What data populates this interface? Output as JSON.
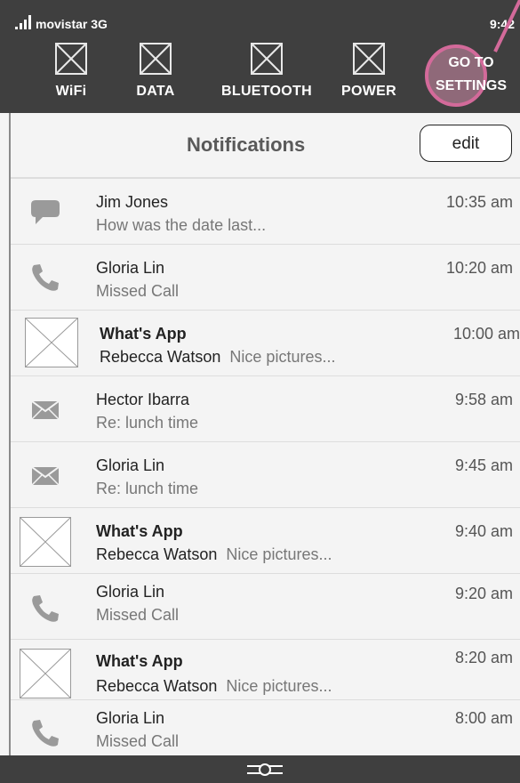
{
  "status": {
    "carrier": "movistar 3G",
    "time": "9:42"
  },
  "quick_settings": [
    {
      "label": "WiFi"
    },
    {
      "label": "DATA"
    },
    {
      "label": "BLUETOOTH"
    },
    {
      "label": "POWER"
    }
  ],
  "go_settings": {
    "line1": "GO TO",
    "line2": "SETTINGS"
  },
  "header": {
    "title": "Notifications",
    "edit_label": "edit"
  },
  "notifications": [
    {
      "icon": "chat-bubble-icon",
      "title": "Jim Jones",
      "sender": "",
      "message": "How was the date last...",
      "time": "10:35 am"
    },
    {
      "icon": "phone-icon",
      "title": "Gloria Lin",
      "sender": "",
      "message": "Missed Call",
      "time": "10:20 am"
    },
    {
      "icon": "app-image-placeholder",
      "title": "What's App",
      "sender": "Rebecca Watson",
      "message": "Nice pictures...",
      "time": "10:00 am"
    },
    {
      "icon": "envelope-icon",
      "title": "Hector Ibarra",
      "sender": "",
      "message": "Re: lunch time",
      "time": "9:58 am"
    },
    {
      "icon": "envelope-icon",
      "title": "Gloria Lin",
      "sender": "",
      "message": "Re: lunch time",
      "time": "9:45 am"
    },
    {
      "icon": "app-image-placeholder",
      "title": "What's App",
      "sender": "Rebecca Watson",
      "message": "Nice pictures...",
      "time": "9:40 am"
    },
    {
      "icon": "phone-icon",
      "title": "Gloria Lin",
      "sender": "",
      "message": "Missed Call",
      "time": "9:20 am"
    },
    {
      "icon": "app-image-placeholder",
      "title": "What's App",
      "sender": "Rebecca Watson",
      "message": "Nice pictures...",
      "time": "8:20 am"
    },
    {
      "icon": "phone-icon",
      "title": "Gloria Lin",
      "sender": "",
      "message": "Missed Call",
      "time": "8:00 am"
    }
  ],
  "colors": {
    "bar": "#3f3f3f",
    "highlight": "#d36a9a",
    "panel": "#f4f4f4"
  }
}
